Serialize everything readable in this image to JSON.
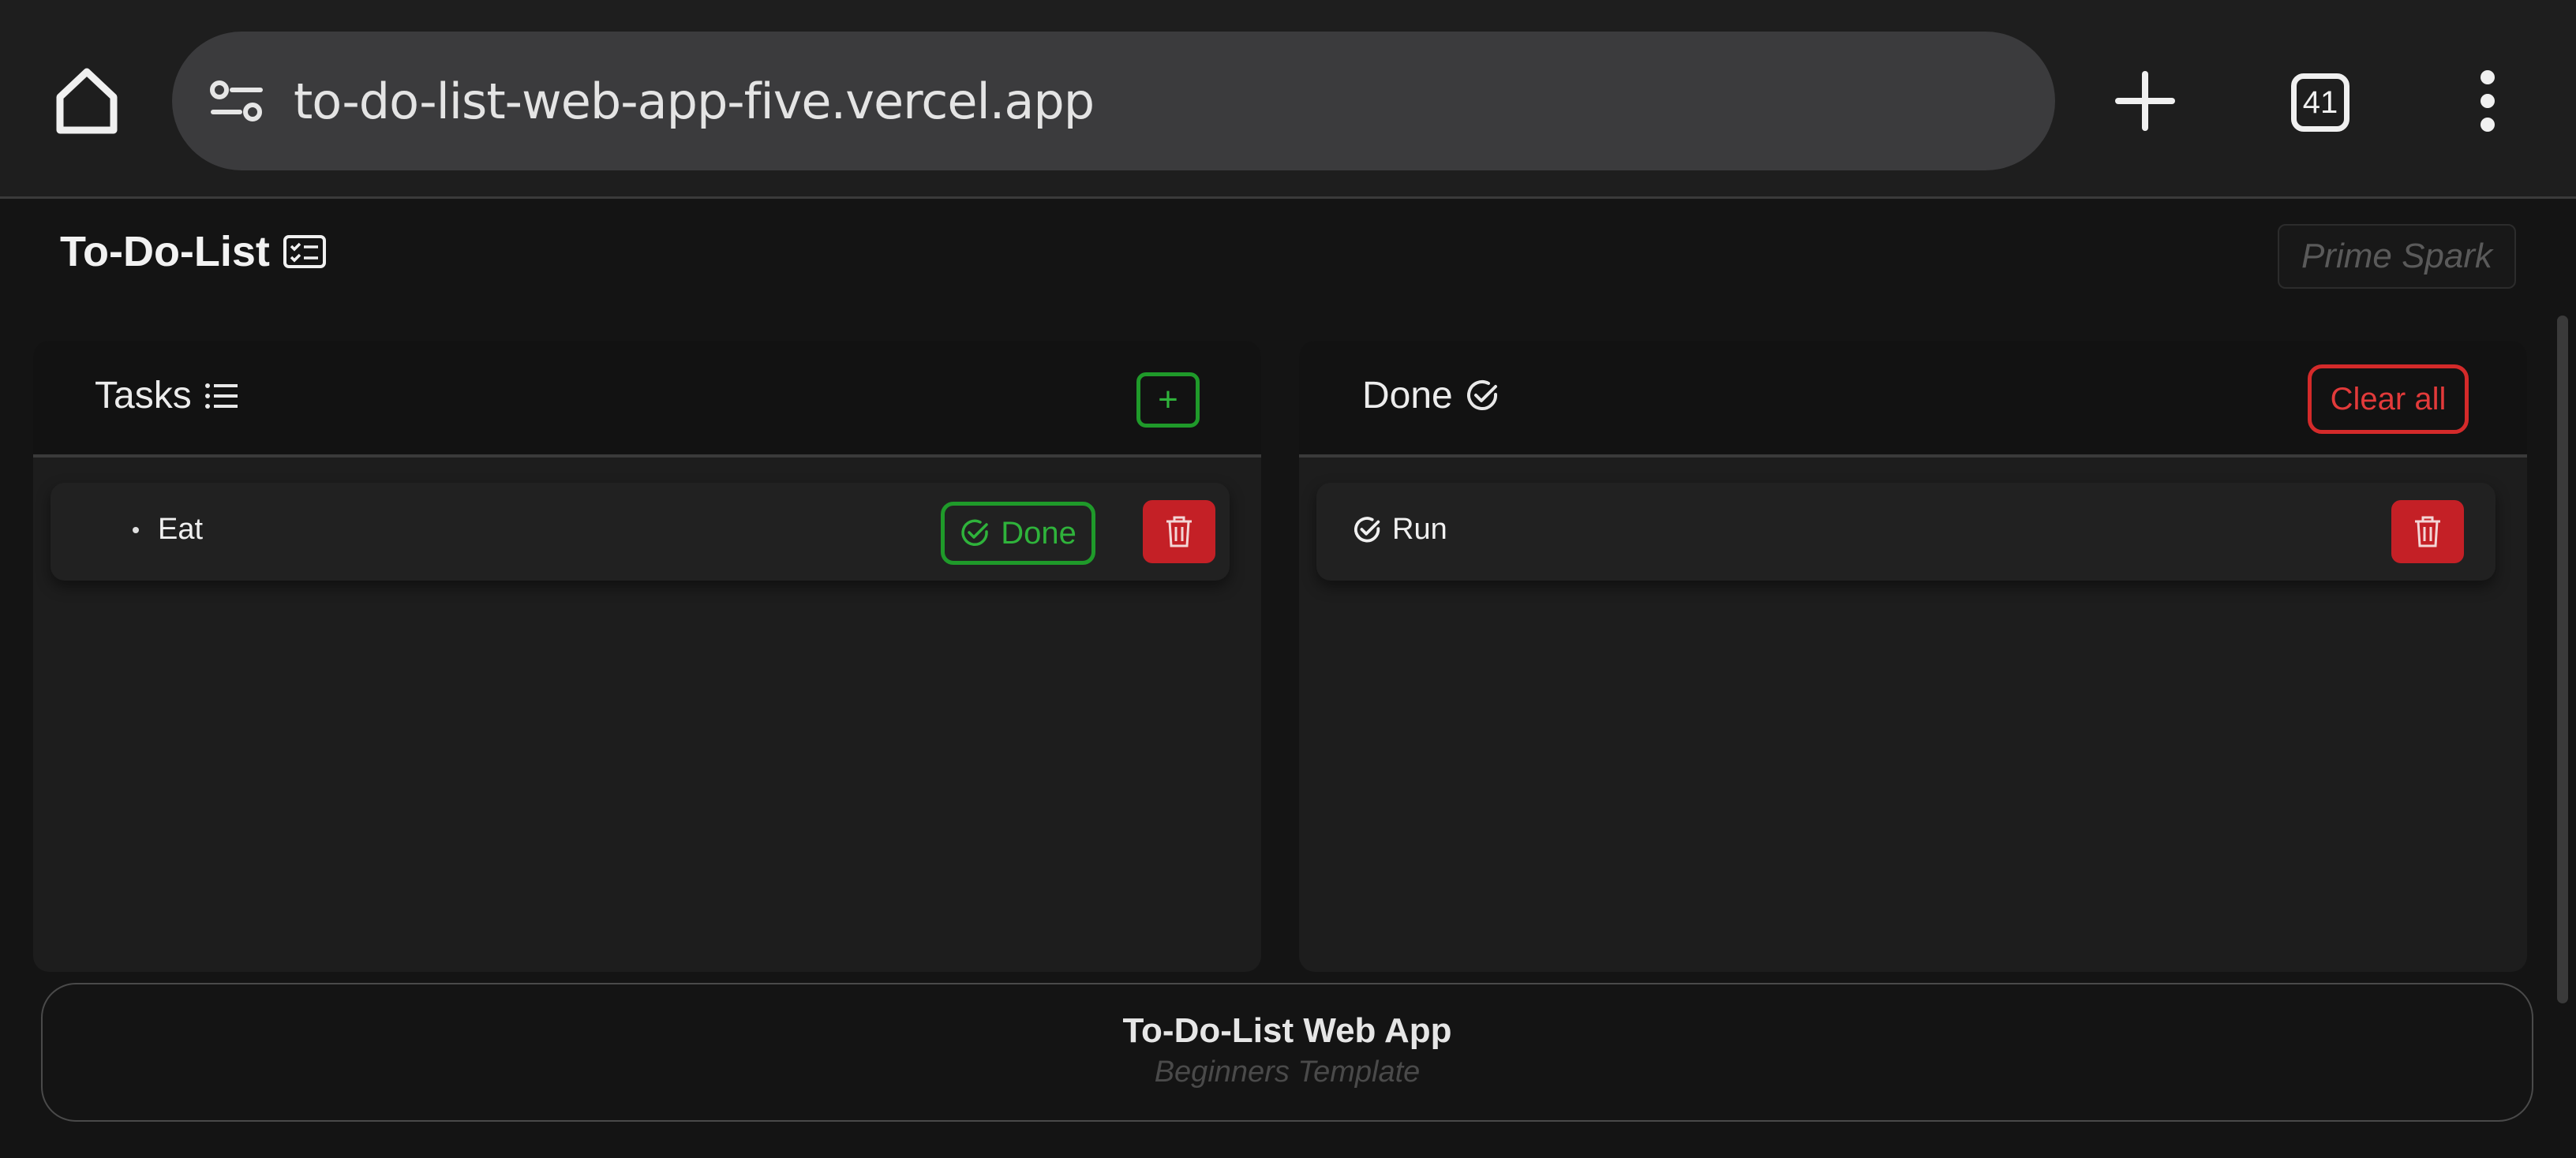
{
  "browser": {
    "url": "to-do-list-web-app-five.vercel.app",
    "tab_count": "41",
    "icons": {
      "home": "home-icon",
      "site_info": "site-settings-icon",
      "new_tab": "plus-icon",
      "tabs": "tab-switcher-icon",
      "menu": "more-vert-icon"
    }
  },
  "header": {
    "title": "To-Do-List",
    "brand": "Prime Spark"
  },
  "tasks_panel": {
    "title": "Tasks",
    "add_label": "+",
    "items": [
      {
        "label": "Eat",
        "done_label": "Done"
      }
    ]
  },
  "done_panel": {
    "title": "Done",
    "clear_label": "Clear all",
    "items": [
      {
        "label": "Run"
      }
    ]
  },
  "footer": {
    "title": "To-Do-List Web App",
    "subtitle": "Beginners Template"
  },
  "colors": {
    "success": "#2fb33b",
    "danger": "#c42026",
    "background": "#141414"
  }
}
